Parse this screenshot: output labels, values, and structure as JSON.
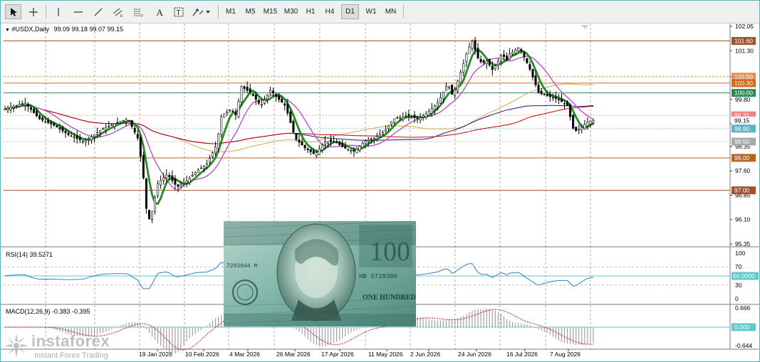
{
  "toolbar": {
    "timeframes": [
      "M1",
      "M5",
      "M15",
      "M30",
      "H1",
      "H4",
      "D1",
      "W1",
      "MN"
    ],
    "active_timeframe": "D1"
  },
  "main_panel": {
    "title": "#USDX,Daily",
    "ohlc": "99.09 99.18 99.07 99.15",
    "price_ticks": [
      "102.05",
      "101.30",
      "100.50",
      "99.80",
      "99.05",
      "98.35",
      "97.60",
      "96.85",
      "96.10",
      "95.35"
    ],
    "levels": [
      {
        "value": 101.6,
        "label": "101.60",
        "color": "#a0522d"
      },
      {
        "value": 100.5,
        "label": "100.50",
        "color": "#e0905a"
      },
      {
        "value": 100.3,
        "label": "100.30",
        "color": "#d2691e"
      },
      {
        "value": 100.0,
        "label": "100.00",
        "color": "#2e8b57"
      },
      {
        "value": 98.0,
        "label": "98.00",
        "color": "#b5651d"
      },
      {
        "value": 97.0,
        "label": "97.00",
        "color": "#a0522d"
      }
    ],
    "markers": [
      {
        "value": 99.31,
        "label": "99.31",
        "color": "#f08080"
      },
      {
        "value": 99.15,
        "label": "99.15",
        "color": "#000000"
      },
      {
        "value": 98.9,
        "label": "98.90",
        "color": "#5fb3c7"
      },
      {
        "value": 98.5,
        "label": "98.50",
        "color": "#a9a9a9"
      }
    ]
  },
  "rsi_panel": {
    "title": "RSI(14) 39.5271",
    "ticks": [
      "100",
      "70",
      "50.0000",
      "30",
      "0"
    ]
  },
  "macd_panel": {
    "title": "MACD(12,26,9) -0.383 -0.395",
    "ticks": [
      "0.666",
      "0.000",
      "-0.644"
    ]
  },
  "date_axis": [
    "19 Jan 2026",
    "10 Feb 2026",
    "4 Mar 2026",
    "26 Mar 2026",
    "17 Apr 2026",
    "11 May 2026",
    "2 Jun 2026",
    "24 Jun 2026",
    "16 Jul 2026",
    "7 Aug 2026"
  ],
  "watermark": {
    "brand": "instaforex",
    "tagline": "Instant Forex Trading"
  },
  "colors": {
    "candle": "#000000",
    "ma_green": "#22aa22",
    "ma_violet": "#b455c8",
    "ma_navy": "#1a1a80",
    "ma_red": "#c80000",
    "ma_gold": "#d4a850",
    "rsi_line": "#1e73be",
    "level_cyan": "#5fc8c8"
  }
}
